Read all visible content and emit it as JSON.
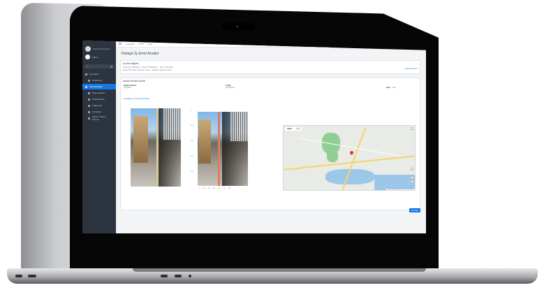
{
  "sidebar": {
    "brand": "Mobilya Belediyesi",
    "user": "Admin",
    "search_placeholder": "Ara...",
    "items": [
      {
        "label": "Ana Sayfa",
        "active": false
      },
      {
        "label": "Dashboard",
        "active": false
      },
      {
        "label": "Saha Raporları",
        "active": true
      },
      {
        "label": "Proje Analizleri",
        "active": false
      },
      {
        "label": "Harita Modülü",
        "active": false
      },
      {
        "label": "Kullanıcılar",
        "active": false
      },
      {
        "label": "Konfigürler",
        "active": false
      },
      {
        "label": "Ayarlar / Sistem Durumu",
        "active": false
      }
    ]
  },
  "topbar": {
    "links": [
      "Anasayfa",
      "Profil",
      "Çıkış"
    ]
  },
  "page": {
    "title": "Detaylı İş Emri Analizi"
  },
  "info_card": {
    "title": "İş Emri Bilgileri",
    "lines": [
      "İş Emri No: 2023/0412 — Durum: Tamamlandı — Tarih: 12.04.2023",
      "Adres: Örnek Mah. Yeşil Sok. No:14 — Açıklama: Kaldırım onarımı"
    ],
    "link": "Detaylı Görünüm"
  },
  "analysis_card": {
    "title": "Analiz Modülü Analizi",
    "meta": [
      {
        "label": "Değerlendirme",
        "value": "Onaylandı"
      },
      {
        "label": "Analiz",
        "value": "Tamamlandı"
      },
      {
        "label": "Skor:",
        "value": "0.89"
      }
    ],
    "section_link": "Fotoğraf ve Tespit Sonuçları",
    "axis_left": [
      "0",
      "100",
      "200",
      "300",
      "400"
    ],
    "axis_bottom": [
      "0",
      "100",
      "200",
      "300",
      "400",
      "500",
      "600"
    ]
  },
  "map": {
    "tabs": [
      "Harita",
      "Uydu"
    ],
    "footer": "Klavye kısayolları  Harita verileri ©2023  Şartlar"
  },
  "actions": {
    "primary_label": "Geri Dön"
  },
  "colors": {
    "sidebar_bg": "#2c3440",
    "accent": "#1677e6",
    "pin": "#e53935"
  }
}
